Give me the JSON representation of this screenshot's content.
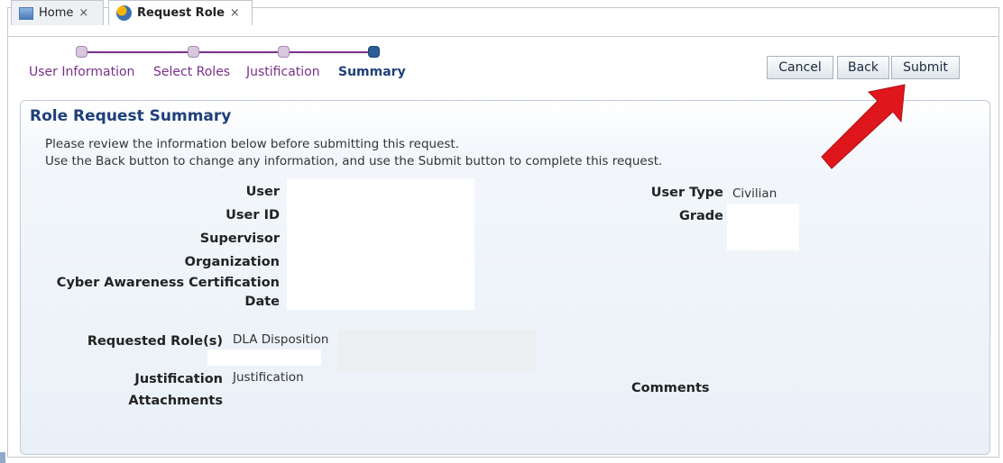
{
  "tabs": [
    {
      "label": "Home",
      "close": "×",
      "icon": "home-icon"
    },
    {
      "label": "Request Role",
      "close": "×",
      "icon": "request-role-icon"
    }
  ],
  "train": {
    "steps": [
      "User Information",
      "Select Roles",
      "Justification",
      "Summary"
    ],
    "current_index": 3
  },
  "buttons": {
    "cancel": "Cancel",
    "back": "Back",
    "submit": "Submit"
  },
  "panel": {
    "title": "Role Request Summary",
    "instruction_1": "Please review the information below before submitting this request.",
    "instruction_2": "Use the Back button to change any information, and use the Submit button to complete this request."
  },
  "fields": {
    "user_label": "User",
    "user_id_label": "User ID",
    "supervisor_label": "Supervisor",
    "organization_label": "Organization",
    "cyber_label_1": "Cyber Awareness Certification",
    "cyber_label_2": "Date",
    "user_type_label": "User Type",
    "user_type_value": "Civilian",
    "grade_label": "Grade",
    "requested_roles_label": "Requested Role(s)",
    "requested_roles_value": "DLA Disposition",
    "justification_label": "Justification",
    "justification_value": "Justification",
    "attachments_label": "Attachments",
    "comments_label": "Comments"
  },
  "colors": {
    "train_purple": "#7a2f8a",
    "title_blue": "#1f3f7a",
    "arrow_red": "#e0161d"
  }
}
